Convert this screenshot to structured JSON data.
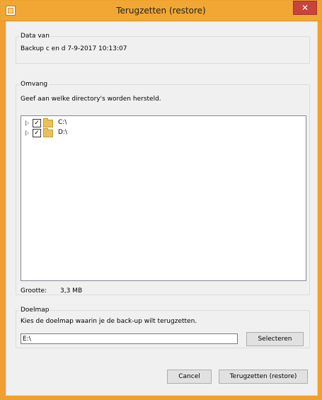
{
  "window": {
    "title": "Terugzetten (restore)",
    "close_label": "✕"
  },
  "data_van": {
    "legend": "Data van",
    "value": "Backup c en d 7-9-2017 10:13:07"
  },
  "omvang": {
    "legend": "Omvang",
    "instruction": "Geef aan welke directory's worden hersteld.",
    "tree": [
      {
        "label": "C:\\",
        "checked": true
      },
      {
        "label": "D:\\",
        "checked": true
      }
    ],
    "size_label": "Grootte:",
    "size_value": "3,3 MB"
  },
  "doelmap": {
    "legend": "Doelmap",
    "instruction": "Kies de doelmap waarin je de back-up wilt terugzetten.",
    "path_value": "E:\\",
    "select_label": "Selecteren"
  },
  "footer": {
    "cancel_label": "Cancel",
    "restore_label": "Terugzetten (restore)"
  }
}
